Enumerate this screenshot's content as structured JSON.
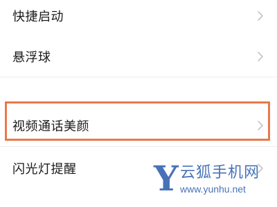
{
  "settings_list": {
    "items": [
      {
        "label": "快捷启动"
      },
      {
        "label": "悬浮球"
      },
      {
        "label": "视频通话美颜",
        "highlighted": true
      },
      {
        "label": "闪光灯提醒"
      }
    ]
  },
  "icons": {
    "row_chevron": "chevron-right-icon"
  },
  "colors": {
    "highlight_border": "#e9784a",
    "watermark": "#2e5fae",
    "label_text": "#1a1a1a",
    "chevron": "#c4c4c4"
  },
  "watermark": {
    "logo_letter": "Y",
    "site_name": "云狐手机网",
    "url": "www.yunhu.net"
  }
}
